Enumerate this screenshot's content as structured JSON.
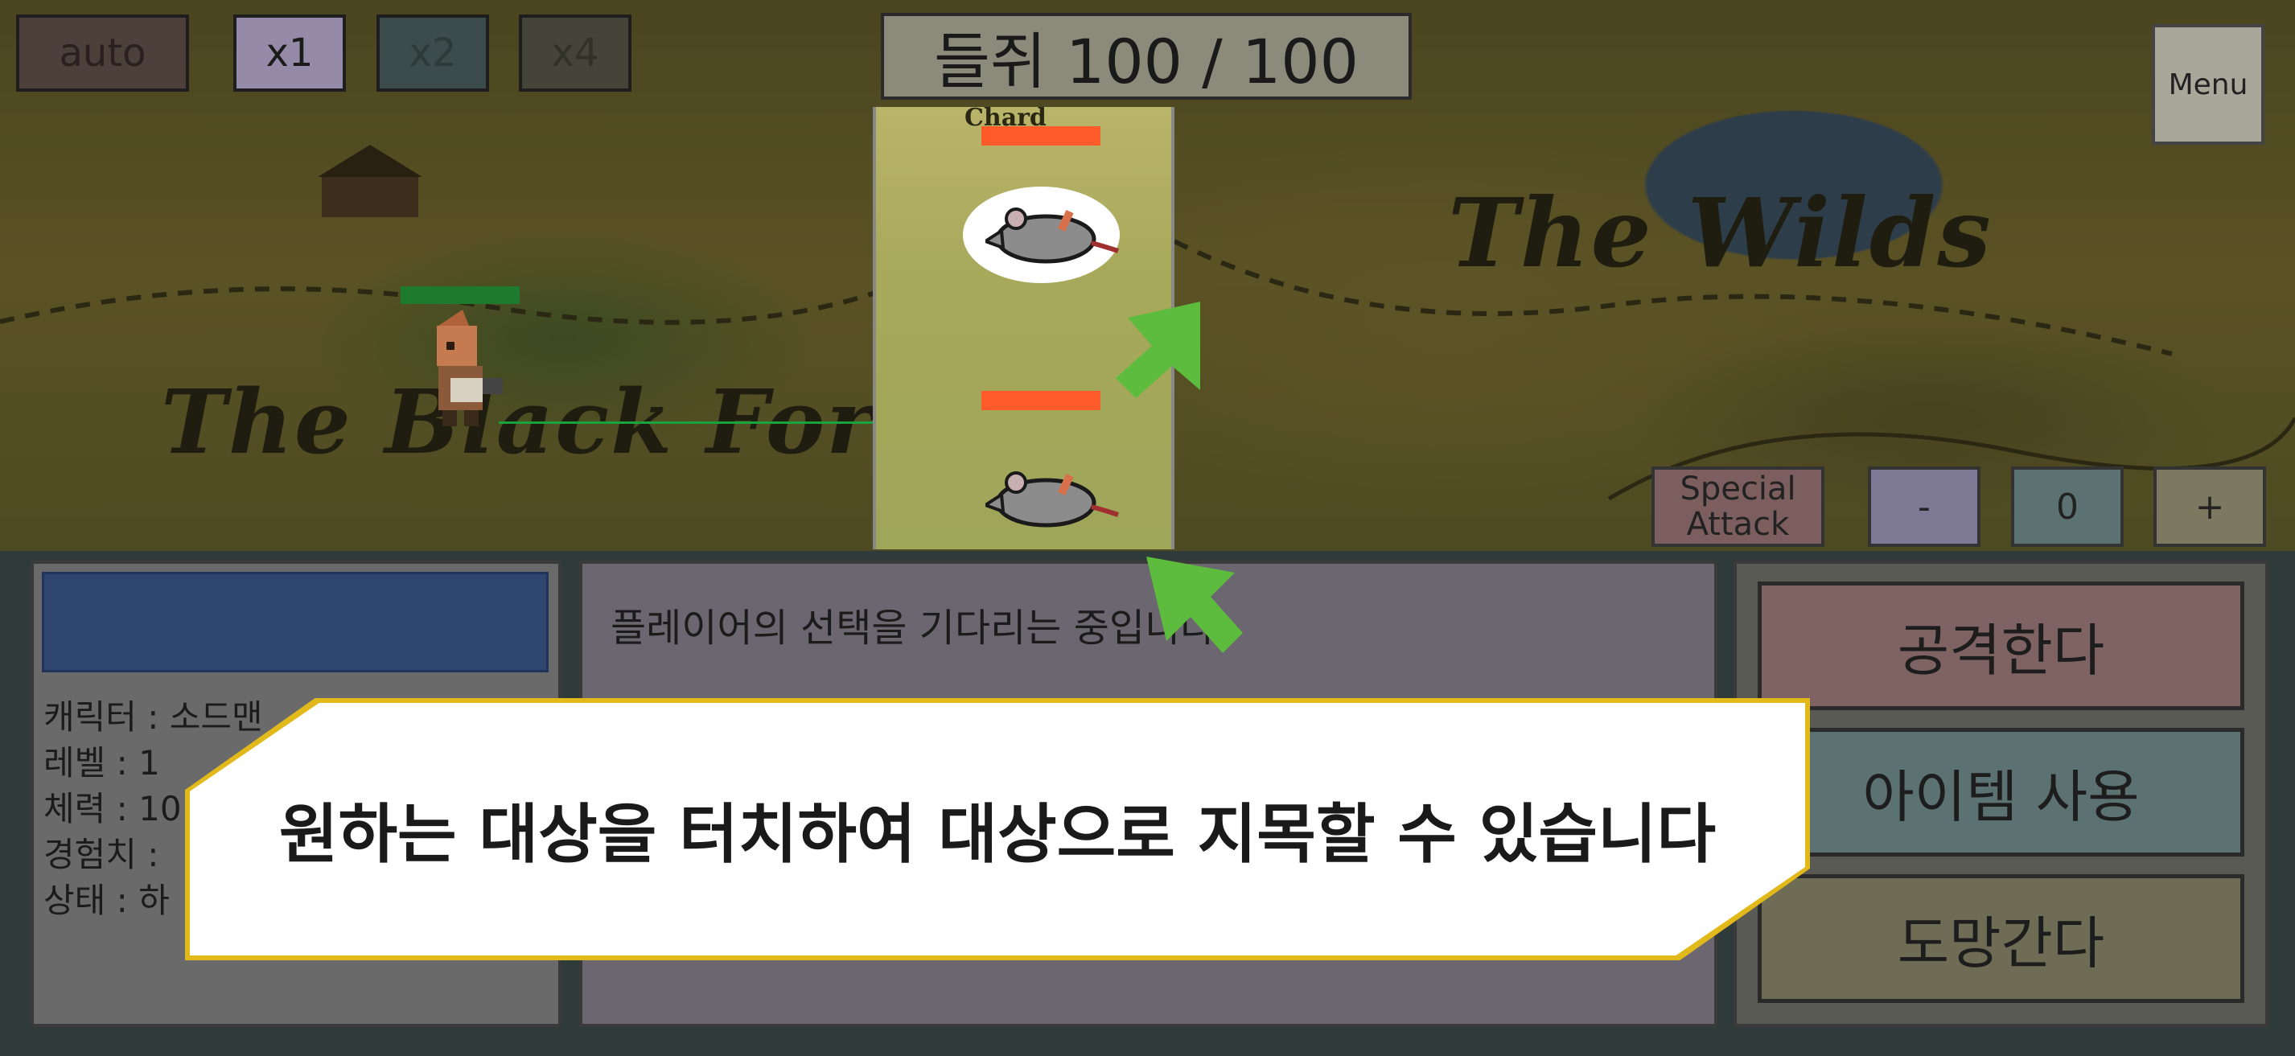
{
  "hud": {
    "speed_buttons": [
      "auto",
      "x1",
      "x2",
      "x4"
    ],
    "enemy_counter": "들쥐 100 / 100",
    "menu_label": "Menu",
    "special_attack_label": "Special Attack",
    "minus_label": "-",
    "count_value": "0",
    "plus_label": "+"
  },
  "map": {
    "labels": [
      "The Wilds",
      "The Black Forest"
    ],
    "small_label": "Chard"
  },
  "player": {
    "hp_fraction": 1.0
  },
  "enemies": [
    {
      "name_icon": "rat-icon",
      "hp_fraction": 1.0,
      "selected": true
    },
    {
      "name_icon": "rat-icon",
      "hp_fraction": 1.0,
      "selected": false
    }
  ],
  "status_panel": {
    "stats": [
      "캐릭터 : 소드맨",
      "레벨 : 1",
      "체력 : 10",
      "경험치 :",
      "상태 : 하"
    ]
  },
  "message_panel": {
    "message": "플레이어의 선택을 기다리는 중입니다."
  },
  "actions": {
    "attack": "공격한다",
    "use_item": "아이템 사용",
    "flee": "도망간다"
  },
  "tutorial": {
    "text": "원하는 대상을 터치하여 대상으로 지목할 수 있습니다"
  },
  "colors": {
    "enemy_hp": "#ff5a2a",
    "player_hp": "#1e7a2e",
    "arrow": "#5dbb3d",
    "callout_border": "#e2b91a"
  }
}
